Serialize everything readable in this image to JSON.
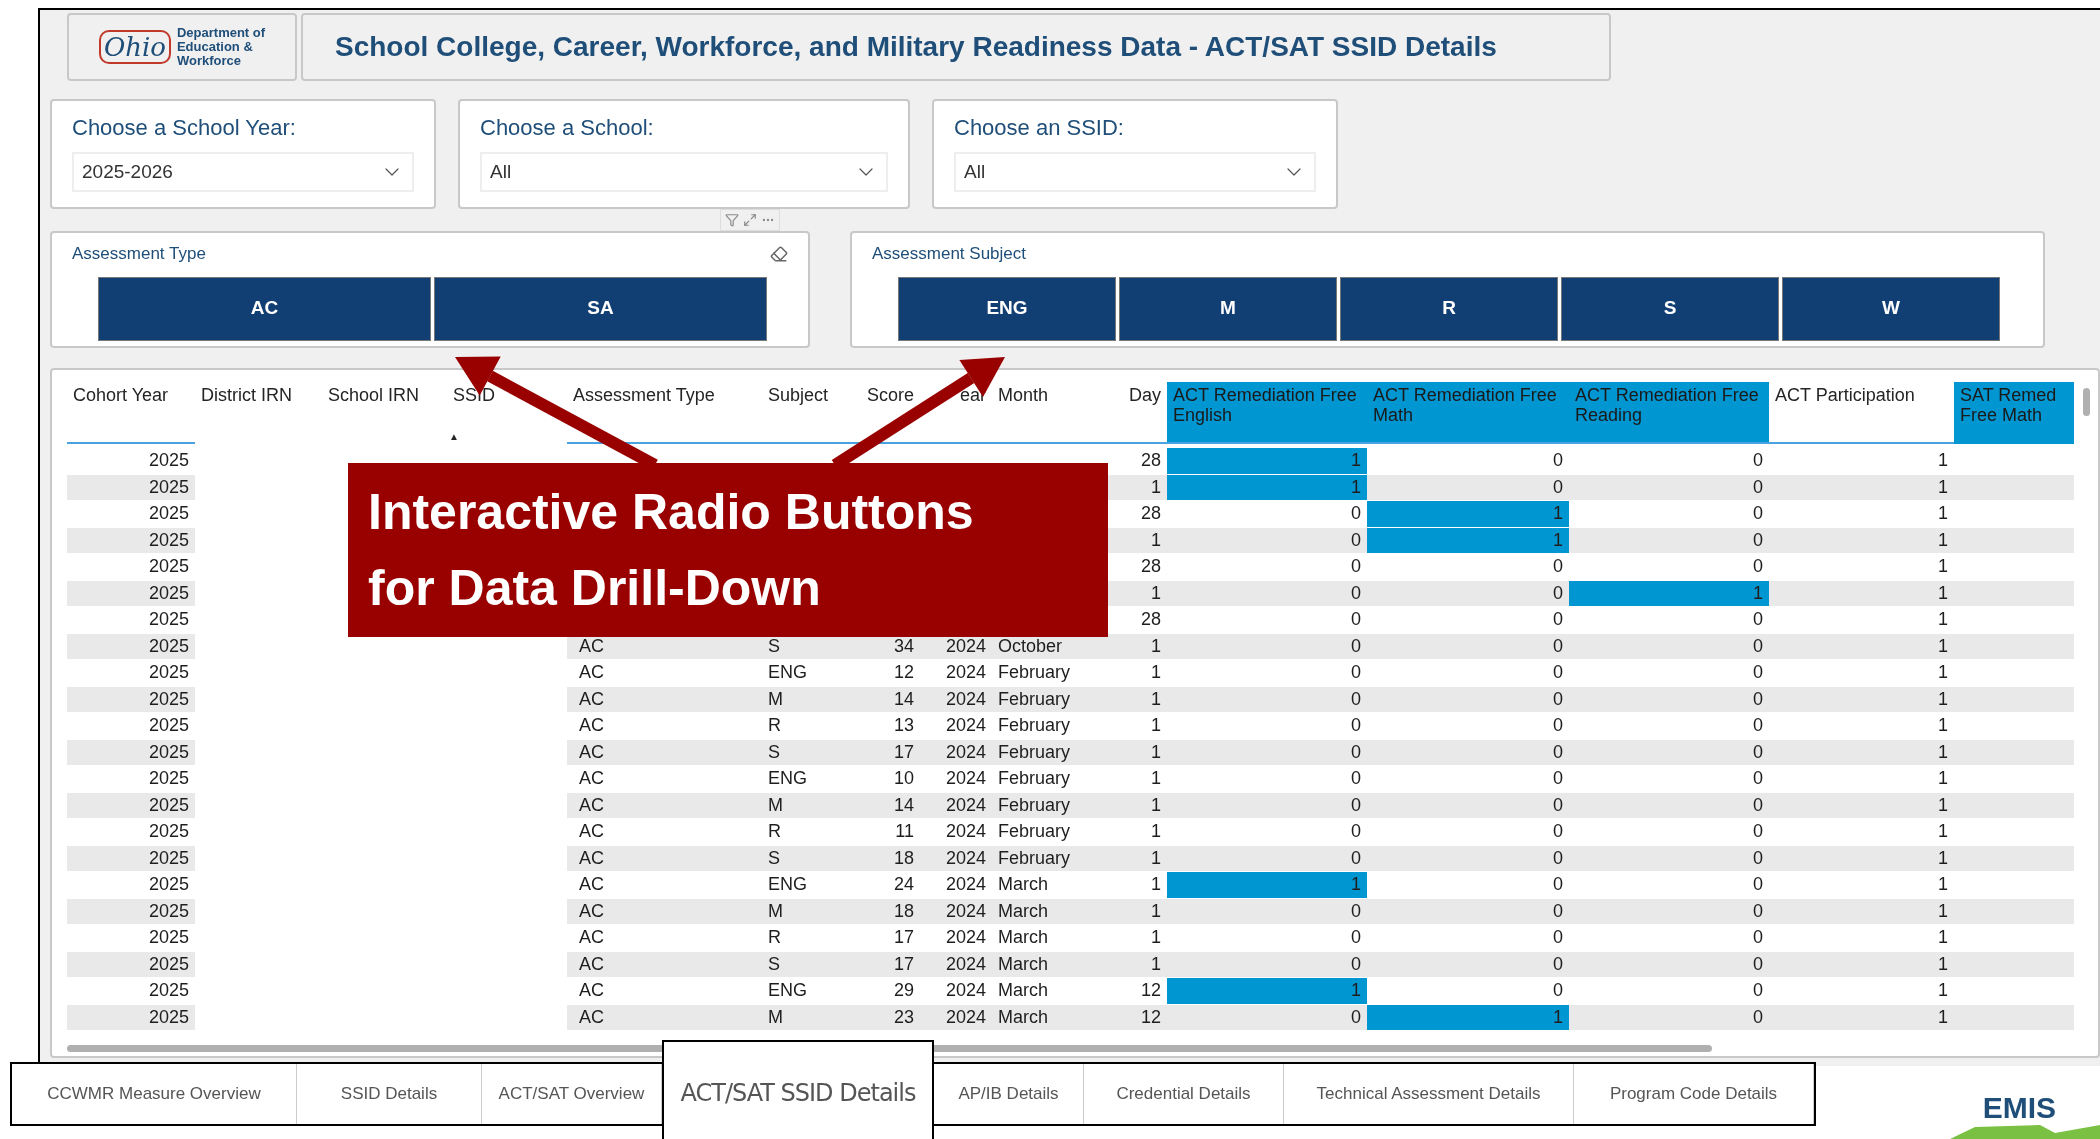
{
  "header": {
    "logo": {
      "wordmark": "Ohio",
      "lines": [
        "Department of",
        "Education &",
        "Workforce"
      ]
    },
    "title": "School College, Career, Workforce, and Military Readiness Data - ACT/SAT SSID Details"
  },
  "filters": [
    {
      "label": "Choose a School Year:",
      "value": "2025-2026"
    },
    {
      "label": "Choose a School:",
      "value": "All"
    },
    {
      "label": "Choose an SSID:",
      "value": "All"
    }
  ],
  "slicers": [
    {
      "title": "Assessment Type",
      "eraser": true,
      "buttons": [
        {
          "label": "AC",
          "selected": false
        },
        {
          "label": "SA",
          "selected": false
        }
      ]
    },
    {
      "title": "Assessment Subject",
      "eraser": false,
      "buttons": [
        {
          "label": "ENG",
          "selected": false
        },
        {
          "label": "M",
          "selected": false
        },
        {
          "label": "R",
          "selected": false
        },
        {
          "label": "S",
          "selected": false
        },
        {
          "label": "W",
          "selected": false
        }
      ]
    }
  ],
  "table": {
    "columns": [
      {
        "label": "Cohort Year",
        "highlighted": false
      },
      {
        "label": "District IRN",
        "highlighted": false
      },
      {
        "label": "School IRN",
        "highlighted": false
      },
      {
        "label": "SSID",
        "highlighted": false,
        "sort_indicator": "▲"
      },
      {
        "label": "Assessment Type",
        "highlighted": false
      },
      {
        "label": "Subject",
        "highlighted": false
      },
      {
        "label": "Score",
        "highlighted": false
      },
      {
        "label": "ear",
        "highlighted": false
      },
      {
        "label": "Month",
        "highlighted": false
      },
      {
        "label": "Day",
        "highlighted": false
      },
      {
        "label": "ACT Remediation Free English",
        "highlighted": true
      },
      {
        "label": "ACT Remediation Free Math",
        "highlighted": true
      },
      {
        "label": "ACT Remediation Free Reading",
        "highlighted": true
      },
      {
        "label": "ACT Participation",
        "highlighted": false
      },
      {
        "label": "SAT Remed Free Math",
        "highlighted": true
      }
    ],
    "rows": [
      {
        "cells": [
          "2025",
          null,
          null,
          null,
          null,
          null,
          null,
          null,
          null,
          "28",
          {
            "value": "1",
            "highlighted": true
          },
          {
            "value": "0",
            "highlighted": false
          },
          {
            "value": "0",
            "highlighted": false
          },
          "1",
          null
        ]
      },
      {
        "cells": [
          "2025",
          null,
          null,
          null,
          null,
          null,
          null,
          null,
          null,
          "1",
          {
            "value": "1",
            "highlighted": true
          },
          {
            "value": "0",
            "highlighted": false
          },
          {
            "value": "0",
            "highlighted": false
          },
          "1",
          null
        ]
      },
      {
        "cells": [
          "2025",
          null,
          null,
          null,
          null,
          null,
          null,
          null,
          null,
          "28",
          {
            "value": "0",
            "highlighted": false
          },
          {
            "value": "1",
            "highlighted": true
          },
          {
            "value": "0",
            "highlighted": false
          },
          "1",
          null
        ]
      },
      {
        "cells": [
          "2025",
          null,
          null,
          null,
          null,
          null,
          null,
          null,
          null,
          "1",
          {
            "value": "0",
            "highlighted": false
          },
          {
            "value": "1",
            "highlighted": true
          },
          {
            "value": "0",
            "highlighted": false
          },
          "1",
          null
        ]
      },
      {
        "cells": [
          "2025",
          null,
          null,
          null,
          null,
          null,
          null,
          null,
          null,
          "28",
          {
            "value": "0",
            "highlighted": false
          },
          {
            "value": "0",
            "highlighted": false
          },
          {
            "value": "0",
            "highlighted": false
          },
          "1",
          null
        ]
      },
      {
        "cells": [
          "2025",
          null,
          null,
          null,
          null,
          null,
          null,
          null,
          null,
          "1",
          {
            "value": "0",
            "highlighted": false
          },
          {
            "value": "0",
            "highlighted": false
          },
          {
            "value": "1",
            "highlighted": true
          },
          "1",
          null
        ]
      },
      {
        "cells": [
          "2025",
          null,
          null,
          null,
          null,
          null,
          null,
          null,
          null,
          "28",
          {
            "value": "0",
            "highlighted": false
          },
          {
            "value": "0",
            "highlighted": false
          },
          {
            "value": "0",
            "highlighted": false
          },
          "1",
          null
        ]
      },
      {
        "cells": [
          "2025",
          null,
          null,
          null,
          "AC",
          "S",
          "34",
          "2024",
          "October",
          "1",
          {
            "value": "0",
            "highlighted": false
          },
          {
            "value": "0",
            "highlighted": false
          },
          {
            "value": "0",
            "highlighted": false
          },
          "1",
          null
        ]
      },
      {
        "cells": [
          "2025",
          null,
          null,
          null,
          "AC",
          "ENG",
          "12",
          "2024",
          "February",
          "1",
          {
            "value": "0",
            "highlighted": false
          },
          {
            "value": "0",
            "highlighted": false
          },
          {
            "value": "0",
            "highlighted": false
          },
          "1",
          null
        ]
      },
      {
        "cells": [
          "2025",
          null,
          null,
          null,
          "AC",
          "M",
          "14",
          "2024",
          "February",
          "1",
          {
            "value": "0",
            "highlighted": false
          },
          {
            "value": "0",
            "highlighted": false
          },
          {
            "value": "0",
            "highlighted": false
          },
          "1",
          null
        ]
      },
      {
        "cells": [
          "2025",
          null,
          null,
          null,
          "AC",
          "R",
          "13",
          "2024",
          "February",
          "1",
          {
            "value": "0",
            "highlighted": false
          },
          {
            "value": "0",
            "highlighted": false
          },
          {
            "value": "0",
            "highlighted": false
          },
          "1",
          null
        ]
      },
      {
        "cells": [
          "2025",
          null,
          null,
          null,
          "AC",
          "S",
          "17",
          "2024",
          "February",
          "1",
          {
            "value": "0",
            "highlighted": false
          },
          {
            "value": "0",
            "highlighted": false
          },
          {
            "value": "0",
            "highlighted": false
          },
          "1",
          null
        ]
      },
      {
        "cells": [
          "2025",
          null,
          null,
          null,
          "AC",
          "ENG",
          "10",
          "2024",
          "February",
          "1",
          {
            "value": "0",
            "highlighted": false
          },
          {
            "value": "0",
            "highlighted": false
          },
          {
            "value": "0",
            "highlighted": false
          },
          "1",
          null
        ]
      },
      {
        "cells": [
          "2025",
          null,
          null,
          null,
          "AC",
          "M",
          "14",
          "2024",
          "February",
          "1",
          {
            "value": "0",
            "highlighted": false
          },
          {
            "value": "0",
            "highlighted": false
          },
          {
            "value": "0",
            "highlighted": false
          },
          "1",
          null
        ]
      },
      {
        "cells": [
          "2025",
          null,
          null,
          null,
          "AC",
          "R",
          "11",
          "2024",
          "February",
          "1",
          {
            "value": "0",
            "highlighted": false
          },
          {
            "value": "0",
            "highlighted": false
          },
          {
            "value": "0",
            "highlighted": false
          },
          "1",
          null
        ]
      },
      {
        "cells": [
          "2025",
          null,
          null,
          null,
          "AC",
          "S",
          "18",
          "2024",
          "February",
          "1",
          {
            "value": "0",
            "highlighted": false
          },
          {
            "value": "0",
            "highlighted": false
          },
          {
            "value": "0",
            "highlighted": false
          },
          "1",
          null
        ]
      },
      {
        "cells": [
          "2025",
          null,
          null,
          null,
          "AC",
          "ENG",
          "24",
          "2024",
          "March",
          "1",
          {
            "value": "1",
            "highlighted": true
          },
          {
            "value": "0",
            "highlighted": false
          },
          {
            "value": "0",
            "highlighted": false
          },
          "1",
          null
        ]
      },
      {
        "cells": [
          "2025",
          null,
          null,
          null,
          "AC",
          "M",
          "18",
          "2024",
          "March",
          "1",
          {
            "value": "0",
            "highlighted": false
          },
          {
            "value": "0",
            "highlighted": false
          },
          {
            "value": "0",
            "highlighted": false
          },
          "1",
          null
        ]
      },
      {
        "cells": [
          "2025",
          null,
          null,
          null,
          "AC",
          "R",
          "17",
          "2024",
          "March",
          "1",
          {
            "value": "0",
            "highlighted": false
          },
          {
            "value": "0",
            "highlighted": false
          },
          {
            "value": "0",
            "highlighted": false
          },
          "1",
          null
        ]
      },
      {
        "cells": [
          "2025",
          null,
          null,
          null,
          "AC",
          "S",
          "17",
          "2024",
          "March",
          "1",
          {
            "value": "0",
            "highlighted": false
          },
          {
            "value": "0",
            "highlighted": false
          },
          {
            "value": "0",
            "highlighted": false
          },
          "1",
          null
        ]
      },
      {
        "cells": [
          "2025",
          null,
          null,
          null,
          "AC",
          "ENG",
          "29",
          "2024",
          "March",
          "12",
          {
            "value": "1",
            "highlighted": true
          },
          {
            "value": "0",
            "highlighted": false
          },
          {
            "value": "0",
            "highlighted": false
          },
          "1",
          null
        ]
      },
      {
        "cells": [
          "2025",
          null,
          null,
          null,
          "AC",
          "M",
          "23",
          "2024",
          "March",
          "12",
          {
            "value": "0",
            "highlighted": false
          },
          {
            "value": "1",
            "highlighted": true
          },
          {
            "value": "0",
            "highlighted": false
          },
          "1",
          null
        ]
      }
    ]
  },
  "callout": {
    "text": "Interactive Radio Buttons for Data Drill-Down"
  },
  "tabs": [
    {
      "label": "CCWMR Measure Overview",
      "selected": false
    },
    {
      "label": "SSID Details",
      "selected": false
    },
    {
      "label": "ACT/SAT Overview",
      "selected": false
    },
    {
      "label": "ACT/SAT SSID Details",
      "selected": true
    },
    {
      "label": "AP/IB Details",
      "selected": false
    },
    {
      "label": "Credential Details",
      "selected": false
    },
    {
      "label": "Technical Assessment Details",
      "selected": false
    },
    {
      "label": "Program Code Details",
      "selected": false
    }
  ],
  "brand": {
    "text": "EMIS"
  }
}
